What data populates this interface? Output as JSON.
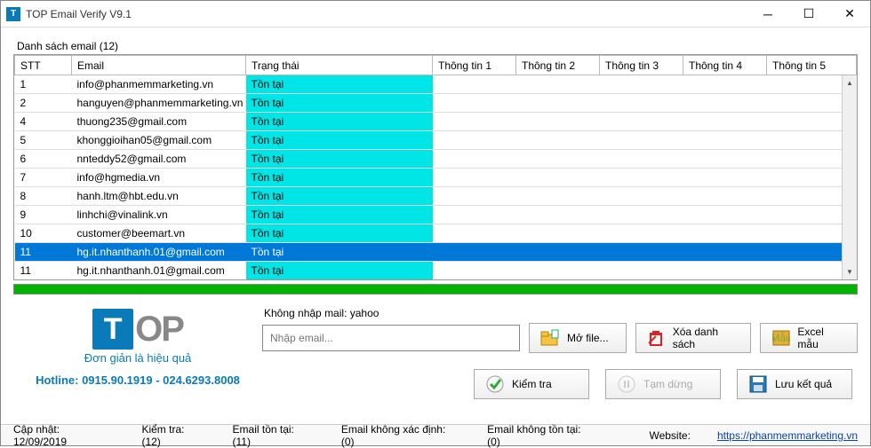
{
  "window": {
    "title": "TOP Email Verify V9.1"
  },
  "list": {
    "label": "Danh sách email (12)",
    "columns": [
      "STT",
      "Email",
      "Trạng thái",
      "Thông tin 1",
      "Thông tin 2",
      "Thông tin 3",
      "Thông tin 4",
      "Thông tin 5"
    ],
    "rows": [
      {
        "stt": "1",
        "email": "info@phanmemmarketing.vn",
        "status": "Tồn tại",
        "sel": false
      },
      {
        "stt": "2",
        "email": "hanguyen@phanmemmarketing.vn",
        "status": "Tồn tại",
        "sel": false
      },
      {
        "stt": "4",
        "email": "thuong235@gmail.com",
        "status": "Tồn tại",
        "sel": false
      },
      {
        "stt": "5",
        "email": "khonggioihan05@gmail.com",
        "status": "Tồn tại",
        "sel": false
      },
      {
        "stt": "6",
        "email": "nnteddy52@gmail.com",
        "status": "Tồn tại",
        "sel": false
      },
      {
        "stt": "7",
        "email": "info@hgmedia.vn",
        "status": "Tồn tại",
        "sel": false
      },
      {
        "stt": "8",
        "email": "hanh.ltm@hbt.edu.vn",
        "status": "Tồn tại",
        "sel": false
      },
      {
        "stt": "9",
        "email": "linhchi@vinalink.vn",
        "status": "Tồn tại",
        "sel": false
      },
      {
        "stt": "10",
        "email": "customer@beemart.vn",
        "status": "Tồn tại",
        "sel": false
      },
      {
        "stt": "11",
        "email": "hg.it.nhanthanh.01@gmail.com",
        "status": "Tồn tại",
        "sel": true
      },
      {
        "stt": "11",
        "email": "hg.it.nhanthanh.01@gmail.com",
        "status": "Tồn tại",
        "sel": false
      }
    ]
  },
  "brand": {
    "slogan": "Đơn giản là hiệu quả",
    "hotline": "Hotline: 0915.90.1919 - 024.6293.8008"
  },
  "controls": {
    "noimport": "Không nhập mail: yahoo",
    "placeholder": "Nhập email...",
    "open": "Mở file...",
    "clear": "Xóa danh sách",
    "sample": "Excel mẫu",
    "check": "Kiểm tra",
    "pause": "Tạm dừng",
    "save": "Lưu kết quả"
  },
  "status": {
    "updated": "Cập nhật: 12/09/2019",
    "checked": "Kiểm tra: (12)",
    "exists": "Email tồn tại: (11)",
    "unknown": "Email không xác định: (0)",
    "notexist": "Email không tồn tại: (0)",
    "weblabel": "Website:",
    "weburl": "https://phanmemmarketing.vn"
  }
}
